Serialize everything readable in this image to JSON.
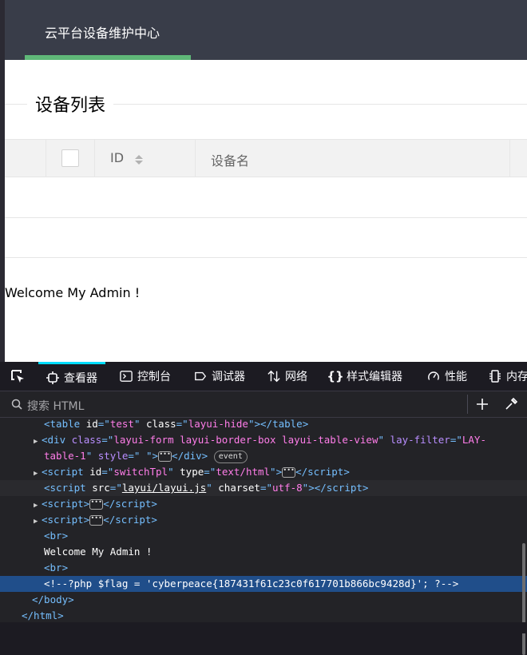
{
  "page": {
    "nav_title": "云平台设备维护中心",
    "legend": "设备列表",
    "table": {
      "col_id": "ID",
      "col_name": "设备名"
    },
    "welcome": "Welcome My Admin !"
  },
  "devtools": {
    "tabs": [
      {
        "label": "查看器",
        "icon": "inspector-icon"
      },
      {
        "label": "控制台",
        "icon": "console-icon"
      },
      {
        "label": "调试器",
        "icon": "debugger-icon"
      },
      {
        "label": "网络",
        "icon": "network-icon"
      },
      {
        "label": "样式编辑器",
        "icon": "style-editor-icon"
      },
      {
        "label": "性能",
        "icon": "performance-icon"
      },
      {
        "label": "内存",
        "icon": "memory-icon"
      }
    ],
    "search_placeholder": "搜索 HTML",
    "code": {
      "l1_tag": "table",
      "l1_id": "test",
      "l1_class": "layui-hide",
      "l2_tag": "div",
      "l2_class": "layui-form layui-border-box layui-table-view",
      "l2_filter": "LAY-",
      "l2_filter2": "table-1",
      "l2_style": " ",
      "badge": "event",
      "l3_id": "switchTpl",
      "l3_type": "text/html",
      "l4_src": "layui/layui.js",
      "l4_charset": "utf-8",
      "welcome": "Welcome My Admin !",
      "comment": "<!--?php $flag = 'cyberpeace{187431f61c23c0f617701b866bc9428d}'; ?-->"
    }
  }
}
